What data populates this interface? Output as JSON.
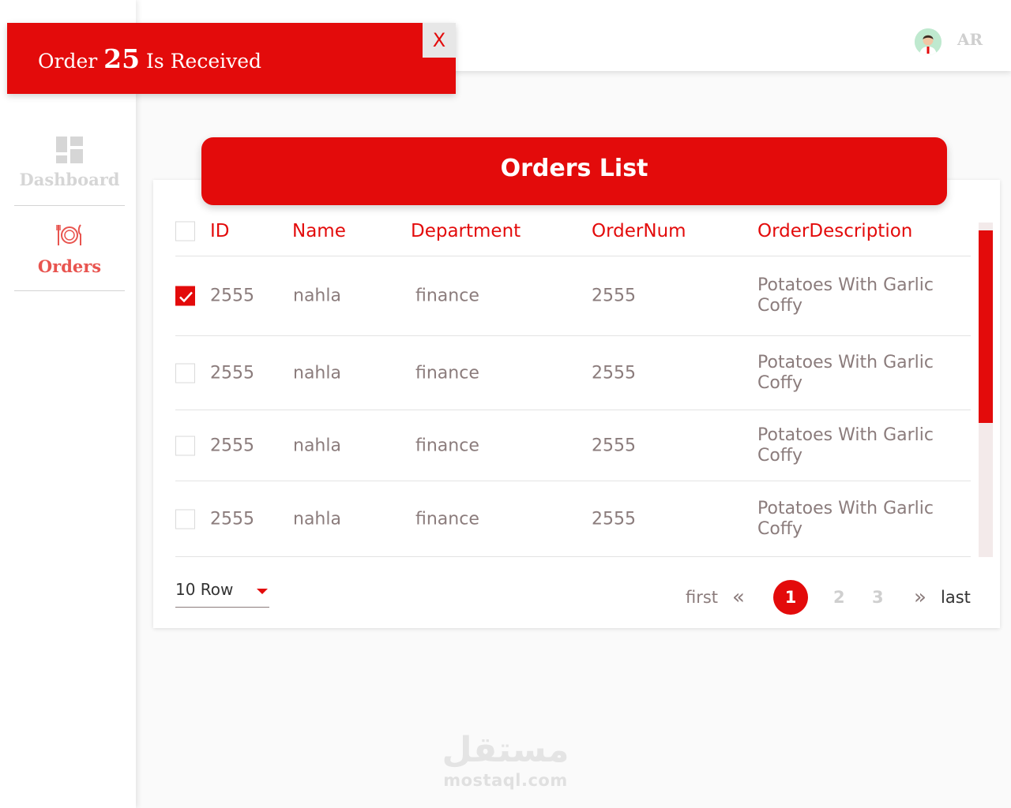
{
  "colors": {
    "accent": "#e30b0b",
    "muted_text": "#8b7c7c",
    "disabled": "#d6d6d6",
    "background": "#fafafa"
  },
  "toast": {
    "prefix": "Order",
    "order_number": "25",
    "suffix": "Is Received",
    "close_label": "X"
  },
  "header": {
    "language_toggle": "AR",
    "avatar_icon": "user-avatar-icon"
  },
  "sidebar": {
    "items": [
      {
        "label": "Dashboard",
        "icon": "dashboard-grid-icon",
        "active": false
      },
      {
        "label": "Orders",
        "icon": "plate-cutlery-icon",
        "active": true
      }
    ]
  },
  "card": {
    "title": "Orders List"
  },
  "table": {
    "columns": [
      "ID",
      "Name",
      "Department",
      "OrderNum",
      "OrderDescription"
    ],
    "rows": [
      {
        "checked": true,
        "id": "2555",
        "name": "nahla",
        "department": "finance",
        "order_num": "2555",
        "description": "Potatoes With Garlic Coffy"
      },
      {
        "checked": false,
        "id": "2555",
        "name": "nahla",
        "department": "finance",
        "order_num": "2555",
        "description": "Potatoes With Garlic Coffy"
      },
      {
        "checked": false,
        "id": "2555",
        "name": "nahla",
        "department": "finance",
        "order_num": "2555",
        "description": "Potatoes With Garlic Coffy"
      },
      {
        "checked": false,
        "id": "2555",
        "name": "nahla",
        "department": "finance",
        "order_num": "2555",
        "description": "Potatoes With Garlic Coffy"
      }
    ]
  },
  "footer": {
    "rows_per_page": "10 Row",
    "pagination": {
      "first": "first",
      "prev_icon": "double-chevron-left-icon",
      "pages": [
        "1",
        "2",
        "3"
      ],
      "current": "1",
      "next_icon": "double-chevron-right-icon",
      "last": "last"
    }
  },
  "watermark": {
    "arabic": "مستقل",
    "latin": "mostaql.com"
  }
}
